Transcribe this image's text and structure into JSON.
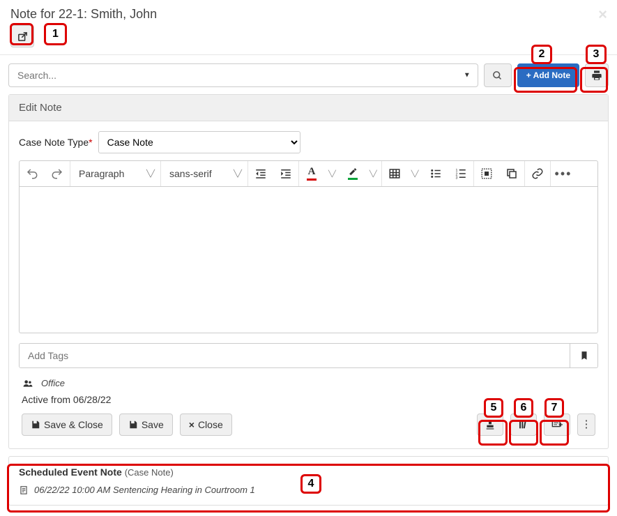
{
  "header": {
    "title": "Note for 22-1: Smith, John"
  },
  "search": {
    "placeholder": "Search..."
  },
  "actions": {
    "add_note": "+  Add Note"
  },
  "panel": {
    "title": "Edit Note"
  },
  "form": {
    "case_note_type_label": "Case Note Type",
    "case_note_type_value": "Case Note"
  },
  "editor": {
    "para_format": "Paragraph",
    "font_family": "sans-serif"
  },
  "tags": {
    "placeholder": "Add Tags"
  },
  "office": {
    "label": "Office"
  },
  "status": {
    "active_from": "Active from 06/28/22"
  },
  "footer": {
    "save_close": "Save & Close",
    "save": "Save",
    "close": "Close"
  },
  "event": {
    "title": "Scheduled Event Note",
    "type": "(Case Note)",
    "line": "06/22/22 10:00 AM Sentencing Hearing in Courtroom 1"
  },
  "annotations": [
    "1",
    "2",
    "3",
    "4",
    "5",
    "6",
    "7"
  ]
}
